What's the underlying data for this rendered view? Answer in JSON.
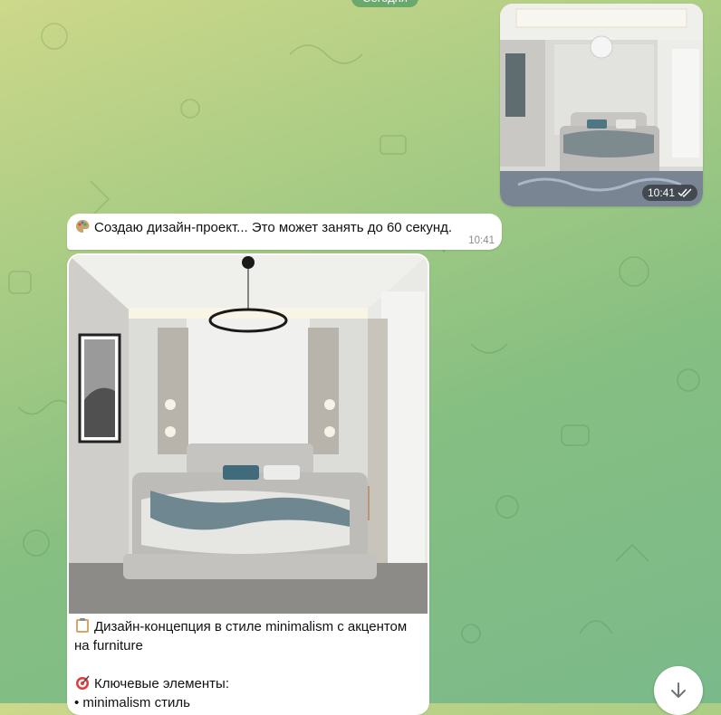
{
  "chat": {
    "date_chip": "Сегодня",
    "outgoing_photo": {
      "time": "10:41",
      "status": "read"
    },
    "status_message": {
      "emoji": "palette-icon",
      "text": "Создаю дизайн-проект... Это может занять до 60 секунд.",
      "time": "10:41"
    },
    "result_message": {
      "caption_line1_emoji": "clipboard-icon",
      "caption_line1": "Дизайн-концепция в стиле minimalism с акцентом на furniture",
      "caption_line2_emoji": "target-icon",
      "caption_line2": "Ключевые элементы:",
      "caption_line3": "• minimalism стиль"
    },
    "scroll_down_icon": "chevron-down-icon"
  },
  "colors": {
    "background_top": "#cdd88a",
    "background_bottom": "#7ab98a",
    "bubble": "#ffffff",
    "date_chip": "#6aa86c"
  }
}
